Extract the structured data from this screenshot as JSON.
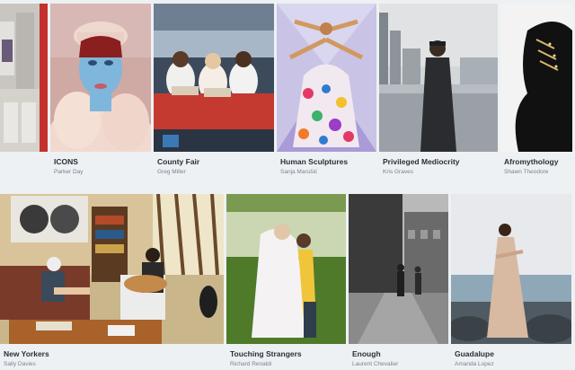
{
  "gallery": {
    "row1": [
      {
        "title": "",
        "author": "",
        "image": "building-edge-photo"
      },
      {
        "title": "ICONS",
        "author": "Parker Day",
        "image": "blue-face-portrait-photo"
      },
      {
        "title": "County Fair",
        "author": "Greg Miller",
        "image": "fair-crowd-photo"
      },
      {
        "title": "Human Sculptures",
        "author": "Sanja Marušić",
        "image": "dancer-sculpture-photo"
      },
      {
        "title": "Privileged Mediocrity",
        "author": "Kris Graves",
        "image": "city-man-photo"
      },
      {
        "title": "Afromythology",
        "author": "Shawn Theodore",
        "image": "profile-portrait-photo"
      }
    ],
    "row2": [
      {
        "title": "New Yorkers",
        "author": "Sally Davies",
        "image": "living-room-photo"
      },
      {
        "title": "Touching Strangers",
        "author": "Richard Renaldi",
        "image": "couple-park-photo"
      },
      {
        "title": "Enough",
        "author": "Laurent Chevalier",
        "image": "street-bw-photo"
      },
      {
        "title": "Guadalupe",
        "author": "Amanda Lopez",
        "image": "beach-dress-photo"
      }
    ]
  }
}
